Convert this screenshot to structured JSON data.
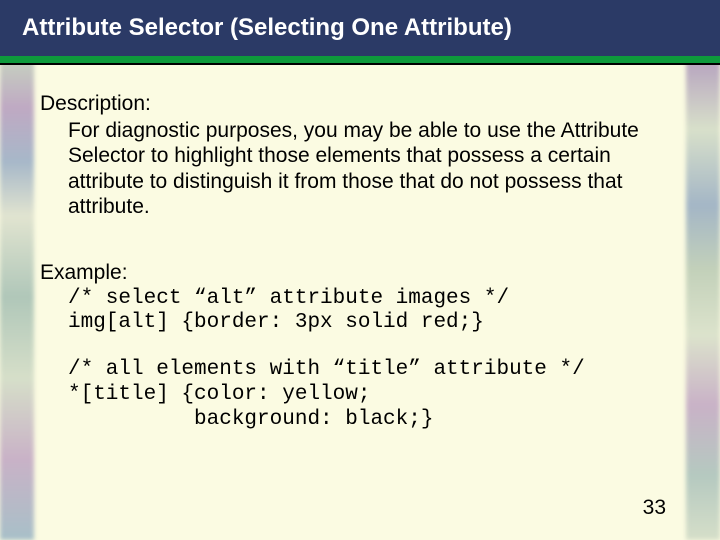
{
  "title": "Attribute Selector (Selecting One Attribute)",
  "description_label": "Description:",
  "description_text": "For diagnostic purposes, you may be able to use the Attribute Selector to highlight those elements that possess a certain attribute to distinguish it from those that do not possess that attribute.",
  "example_label": "Example:",
  "code": {
    "line1": "/* select “alt” attribute images */",
    "line2": "img[alt] {border: 3px solid red;}",
    "line3": "/* all elements with “title” attribute */",
    "line4": "*[title] {color: yellow;",
    "line5": "          background: black;}"
  },
  "page_number": "33"
}
